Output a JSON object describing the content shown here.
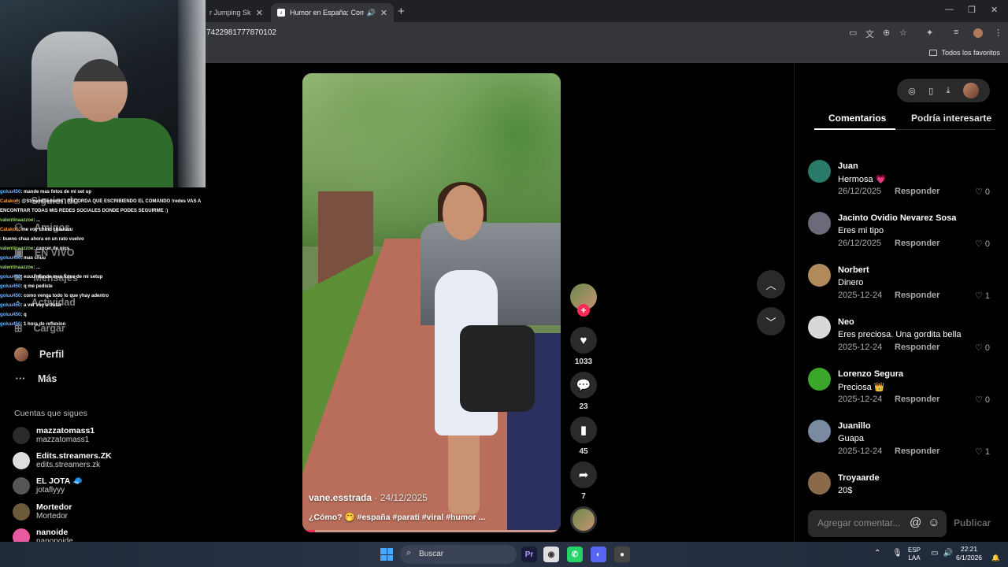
{
  "browser": {
    "tabs": [
      {
        "title": "r Jumping Skills"
      },
      {
        "title": "Humor en España: Como M"
      }
    ],
    "new_tab": "+",
    "url": "7422981777870102",
    "bookmark": "Todos los favoritos",
    "window_controls": [
      "—",
      "❐",
      "✕"
    ]
  },
  "sidebar": {
    "items": [
      {
        "label": "Siguiendo",
        "icon": "following-icon"
      },
      {
        "label": "Amigos",
        "icon": "friends-icon"
      },
      {
        "label": "EN VIVO",
        "icon": "live-icon"
      },
      {
        "label": "Mensajes",
        "icon": "messages-icon"
      },
      {
        "label": "Actividad",
        "icon": "activity-icon"
      },
      {
        "label": "Cargar",
        "icon": "upload-icon"
      },
      {
        "label": "Perfil",
        "icon": "profile-icon"
      },
      {
        "label": "Más",
        "icon": "more-icon"
      }
    ],
    "following_header": "Cuentas que sigues",
    "following": [
      {
        "name": "mazzatomass1",
        "handle": "mazzatomass1"
      },
      {
        "name": "Edits.streamers.ZK",
        "handle": "edits.streamers.zk"
      },
      {
        "name": "EL JOTA 🧢",
        "handle": "jotaflyyy"
      },
      {
        "name": "Mortedor",
        "handle": "Mortedor"
      },
      {
        "name": "nanoide",
        "handle": "nanonoide"
      }
    ]
  },
  "chat": [
    {
      "user": "goluu450",
      "msg": ": mande mas fotos de mi set up"
    },
    {
      "user": "Catakoo",
      "msg": ": @StreamElements : RECORDA QUE ESCRIBIENDO EL COMANDO !redes VAS A"
    },
    {
      "user": "",
      "msg": "ENCONTRAR TODAS MIS REDES SOCIALES DONDE PODES SEGUIRME :)"
    },
    {
      "user": "valentinaazzoe",
      "msg": ": ..."
    },
    {
      "user": "Catakoo",
      "msg": ": me voy chino chauuuu"
    },
    {
      "user": "",
      "msg": ": bueno chau ahora en un rato vuelvo"
    },
    {
      "user": "valentinaazzoe",
      "msg": ": cancer de ojos"
    },
    {
      "user": "goluu450",
      "msg": ": mas chuu"
    },
    {
      "user": "valentinaazzoe",
      "msg": ": ..."
    },
    {
      "user": "goluu450",
      "msg": ": euuu mande mas fotos de mi setup"
    },
    {
      "user": "goluu450",
      "msg": ": q me pediste"
    },
    {
      "user": "goluu450",
      "msg": ": como venga todo lo que yhay adentro"
    },
    {
      "user": "goluu450",
      "msg": ": a ver voy a tratar"
    },
    {
      "user": "goluu450",
      "msg": ": q"
    },
    {
      "user": "goluu450",
      "msg": ": 1 hora de reflexion"
    }
  ],
  "video": {
    "author": "vane.esstrada",
    "date": "· 24/12/2025",
    "caption": "¿Cómo? 🤭 #españa #parati #viral #humor ...",
    "progress": 0.05
  },
  "actions": {
    "likes": "1033",
    "comments": "23",
    "saves": "45",
    "shares": "7"
  },
  "panel": {
    "tabs": [
      "Comentarios",
      "Podría interesarte"
    ],
    "comments": [
      {
        "name": "Juan",
        "text": "Hermosa 💗",
        "date": "26/12/2025",
        "reply": "Responder",
        "likes": "0",
        "color": "#2a7a6a"
      },
      {
        "name": "Jacinto Ovidio Nevarez Sosa",
        "text": "Eres mi tipo",
        "date": "26/12/2025",
        "reply": "Responder",
        "likes": "0",
        "color": "#6a6a7a"
      },
      {
        "name": "Norbert",
        "text": "Dinero",
        "date": "2025-12-24",
        "reply": "Responder",
        "likes": "1",
        "color": "#b08a5a"
      },
      {
        "name": "Neo",
        "text": "Eres preciosa. Una gordita bella",
        "date": "2025-12-24",
        "reply": "Responder",
        "likes": "0",
        "color": "#d8d8d8"
      },
      {
        "name": "Lorenzo Segura",
        "text": "Preciosa 👑",
        "date": "2025-12-24",
        "reply": "Responder",
        "likes": "0",
        "color": "#3aa62a"
      },
      {
        "name": "Juanillo",
        "text": "Guapa",
        "date": "2025-12-24",
        "reply": "Responder",
        "likes": "1",
        "color": "#7a8aa0"
      },
      {
        "name": "Troyaarde",
        "text": "20$",
        "date": "",
        "reply": "",
        "likes": "",
        "color": "#8a6a4a"
      }
    ],
    "add_placeholder": "Agregar comentar...",
    "publish": "Publicar"
  },
  "taskbar": {
    "search": "Buscar",
    "lang": "ESP",
    "lang2": "LAA",
    "time": "22:21",
    "date": "6/1/2026"
  }
}
